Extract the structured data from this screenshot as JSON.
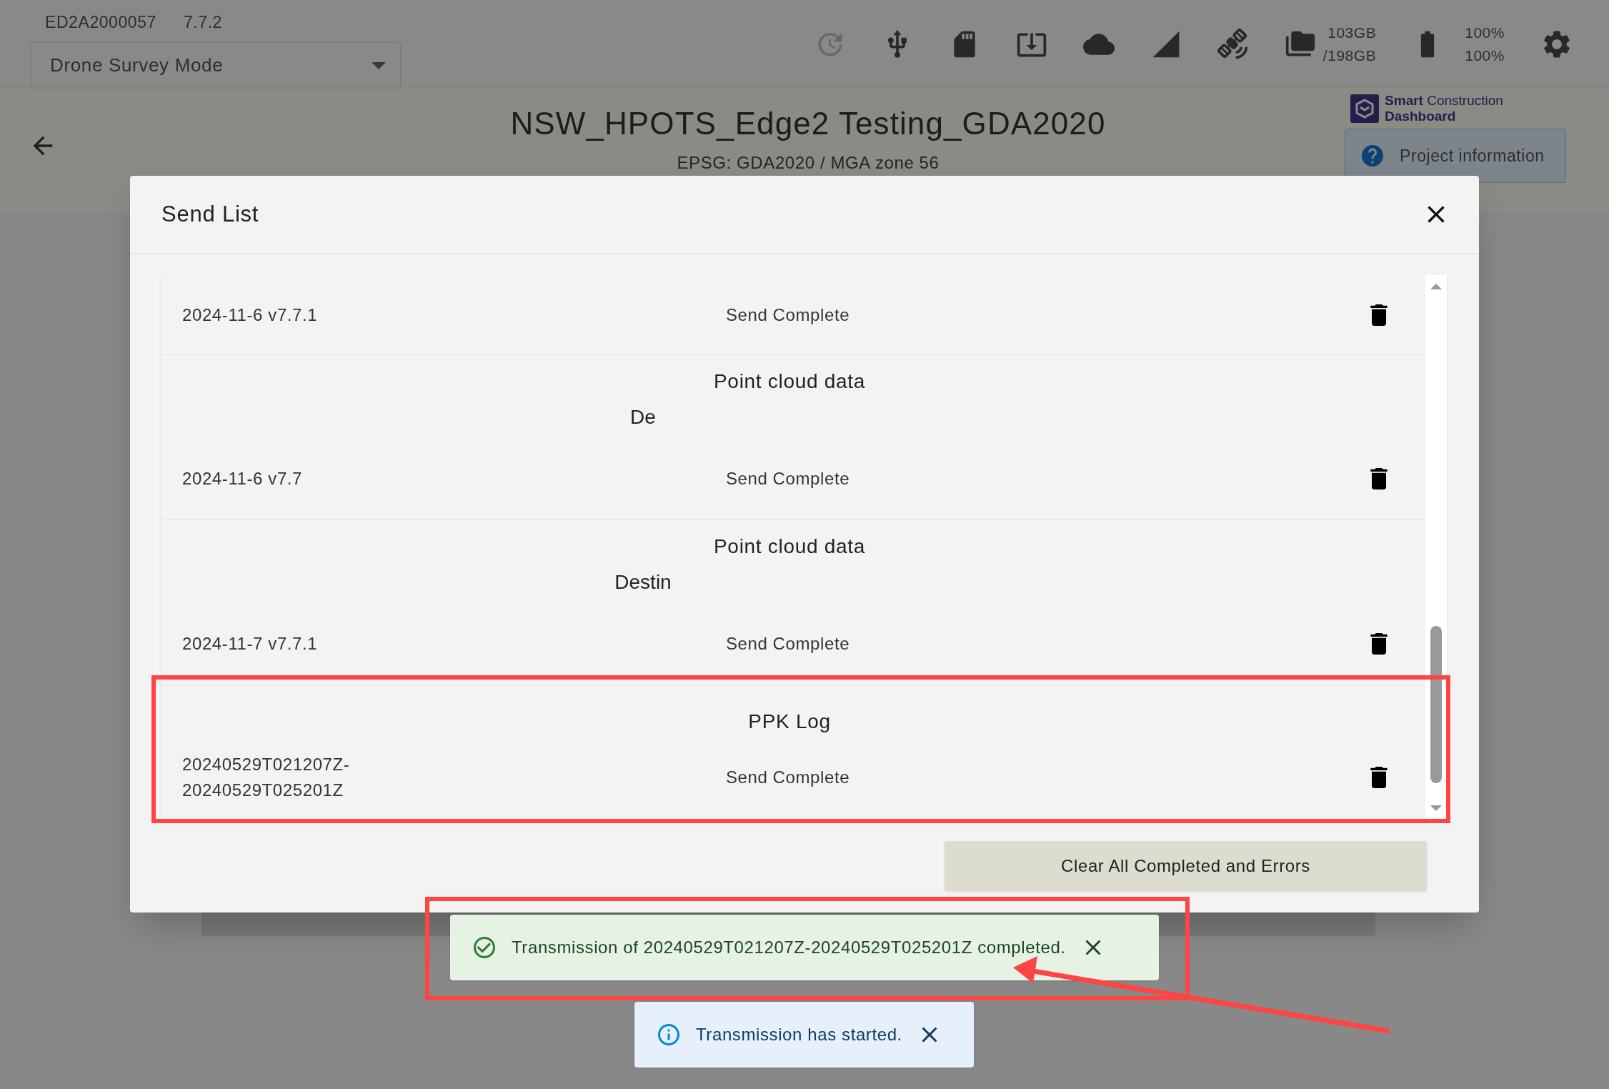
{
  "device": {
    "serial": "ED2A2000057",
    "version": "7.7.2"
  },
  "mode_select": {
    "value": "Drone Survey Mode"
  },
  "storage": {
    "used": "103GB",
    "total": "/198GB"
  },
  "battery": {
    "readings": [
      "100%",
      "100%"
    ]
  },
  "project": {
    "title": "NSW_HPOTS_Edge2 Testing_GDA2020",
    "crs": "EPSG: GDA2020 / MGA zone 56"
  },
  "logo": {
    "line1": "**Smart** Construction",
    "line2": "Dashboard"
  },
  "project_info_button": {
    "label": "Project information"
  },
  "dialog": {
    "title": "Send List",
    "rows": [
      {
        "name": "2024-11-6 v7.7.1",
        "status": "Send Complete"
      },
      {
        "title": "Point cloud data",
        "subtitle": "De",
        "name": "2024-11-6 v7.7",
        "status": "Send Complete"
      },
      {
        "title": "Point cloud data",
        "subtitle": "Destin",
        "name": "2024-11-7 v7.7.1",
        "status": "Send Complete"
      },
      {
        "title": "PPK Log",
        "name": "20240529T021207Z-20240529T025201Z",
        "status": "Send Complete"
      }
    ],
    "clear_button": "Clear All Completed and Errors"
  },
  "toasts": [
    {
      "kind": "success",
      "message": "Transmission of 20240529T021207Z-20240529T025201Z completed."
    },
    {
      "kind": "info",
      "message": "Transmission has started."
    }
  ]
}
